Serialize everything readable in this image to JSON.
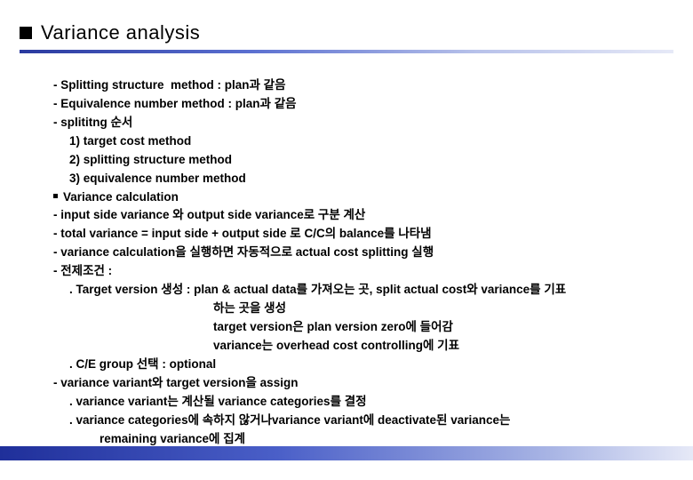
{
  "header": {
    "title": "Variance analysis"
  },
  "lines": [
    {
      "cls": "i0",
      "text": "- Splitting structure  method : plan과 같음"
    },
    {
      "cls": "i0",
      "text": "- Equivalence number method : plan과 같음"
    },
    {
      "cls": "i0",
      "text": "- splititng 순서"
    },
    {
      "cls": "i1",
      "text": "1) target cost method"
    },
    {
      "cls": "i1",
      "text": "2) splitting structure method"
    },
    {
      "cls": "i1",
      "text": "3) equivalence number method"
    },
    {
      "cls": "i0",
      "bullet": true,
      "text": "Variance calculation"
    },
    {
      "cls": "i0",
      "text": "- input side variance 와 output side variance로 구분 계산"
    },
    {
      "cls": "i0",
      "text": "- total variance = input side + output side 로 C/C의 balance를 나타냄"
    },
    {
      "cls": "i0",
      "text": "- variance calculation을 실행하면 자동적으로 actual cost splitting 실행"
    },
    {
      "cls": "i0",
      "text": "- 전제조건 :"
    },
    {
      "cls": "i1",
      "text": ". Target version 생성 : plan & actual data를 가져오는 곳, split actual cost와 variance를 기표"
    },
    {
      "cls": "i3",
      "text": "하는 곳을 생성"
    },
    {
      "cls": "i3",
      "text": "target version은 plan version zero에 들어감"
    },
    {
      "cls": "i3",
      "text": "variance는 overhead cost controlling에 기표"
    },
    {
      "cls": "i1",
      "text": ". C/E group 선택 : optional"
    },
    {
      "cls": "i0",
      "text": "- variance variant와 target version을 assign"
    },
    {
      "cls": "i1",
      "text": ". variance variant는 계산될 variance categories를 결정"
    },
    {
      "cls": "i1",
      "text": ". variance categories에 속하지 않거나variance variant에 deactivate된 variance는"
    },
    {
      "cls": "i2",
      "text": "remaining variance에 집계"
    }
  ]
}
